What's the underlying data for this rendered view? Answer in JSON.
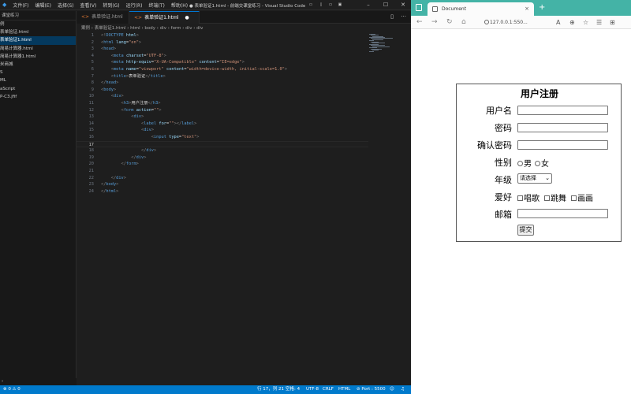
{
  "vscode": {
    "menu": [
      "文件(F)",
      "编辑(E)",
      "选择(S)",
      "查看(V)",
      "转到(G)",
      "运行(R)",
      "终端(T)",
      "帮助(H)"
    ],
    "window_title": "● 表单验证1.html - 前端交课堂练习 - Visual Studio Code",
    "sidebar_header": "课堂练习",
    "tree": [
      "例",
      "表单验证.html",
      "表单验证1.html",
      "简易计算器.html",
      "简易计算器1.html",
      "米商城",
      "S",
      "ML",
      "aScript",
      "P-C3.jfif"
    ],
    "tree_active_index": 2,
    "tabs": [
      {
        "label": "表单验证.html"
      },
      {
        "label": "表单验证1.html",
        "modified": "●"
      }
    ],
    "breadcrumb": "案例 › 表单验证1.html › html › body › div › form › div › div",
    "lines": [
      {
        "n": "1",
        "html": "<span class='p'>&lt;!</span><span class='t'>DOCTYPE</span> <span class='a'>html</span><span class='p'>&gt;</span>"
      },
      {
        "n": "2",
        "html": "<span class='p'>&lt;</span><span class='t'>html</span> <span class='a'>lang</span><span class='x'>=</span><span class='s'>\"en\"</span><span class='p'>&gt;</span>"
      },
      {
        "n": "3",
        "html": "<span class='p'>&lt;</span><span class='t'>head</span><span class='p'>&gt;</span>"
      },
      {
        "n": "4",
        "html": "    <span class='p'>&lt;</span><span class='t'>meta</span> <span class='a'>charset</span><span class='x'>=</span><span class='s'>\"UTF-8\"</span><span class='p'>&gt;</span>"
      },
      {
        "n": "5",
        "html": "    <span class='p'>&lt;</span><span class='t'>meta</span> <span class='a'>http-equiv</span><span class='x'>=</span><span class='s'>\"X-UA-Compatible\"</span> <span class='a'>content</span><span class='x'>=</span><span class='s'>\"IE=edge\"</span><span class='p'>&gt;</span>"
      },
      {
        "n": "6",
        "html": "    <span class='p'>&lt;</span><span class='t'>meta</span> <span class='a'>name</span><span class='x'>=</span><span class='s'>\"viewport\"</span> <span class='a'>content</span><span class='x'>=</span><span class='s'>\"width=device-width, initial-scale=1.0\"</span><span class='p'>&gt;</span>"
      },
      {
        "n": "7",
        "html": "    <span class='p'>&lt;</span><span class='t'>title</span><span class='p'>&gt;</span><span class='x'>表单验证</span><span class='p'>&lt;/</span><span class='t'>title</span><span class='p'>&gt;</span>"
      },
      {
        "n": "8",
        "html": "<span class='p'>&lt;/</span><span class='t'>head</span><span class='p'>&gt;</span>"
      },
      {
        "n": "9",
        "html": "<span class='p'>&lt;</span><span class='t'>body</span><span class='p'>&gt;</span>"
      },
      {
        "n": "10",
        "html": "    <span class='p'>&lt;</span><span class='t'>div</span><span class='p'>&gt;</span>"
      },
      {
        "n": "11",
        "html": "        <span class='p'>&lt;</span><span class='t'>h3</span><span class='p'>&gt;</span><span class='x'>用户注册</span><span class='p'>&lt;/</span><span class='t'>h3</span><span class='p'>&gt;</span>"
      },
      {
        "n": "12",
        "html": "        <span class='p'>&lt;</span><span class='t'>form</span> <span class='a'>action</span><span class='x'>=</span><span class='s'>\"\"</span><span class='p'>&gt;</span>"
      },
      {
        "n": "13",
        "html": "            <span class='p'>&lt;</span><span class='t'>div</span><span class='p'>&gt;</span>"
      },
      {
        "n": "14",
        "html": "                <span class='p'>&lt;</span><span class='t'>label</span> <span class='a'>for</span><span class='x'>=</span><span class='s'>\"\"</span><span class='p'>&gt;&lt;/</span><span class='t'>label</span><span class='p'>&gt;</span>"
      },
      {
        "n": "15",
        "html": "                <span class='p'>&lt;</span><span class='t'>div</span><span class='p'>&gt;</span>"
      },
      {
        "n": "16",
        "html": "                    <span class='p'>&lt;</span><span class='t'>input</span> <span class='a'>type</span><span class='x'>=</span><span class='s'>\"text\"</span><span class='p'>&gt;</span>"
      },
      {
        "n": "17",
        "html": "",
        "current": true
      },
      {
        "n": "18",
        "html": "                <span class='p'>&lt;/</span><span class='t'>div</span><span class='p'>&gt;</span>"
      },
      {
        "n": "19",
        "html": "            <span class='p'>&lt;/</span><span class='t'>div</span><span class='p'>&gt;</span>"
      },
      {
        "n": "20",
        "html": "        <span class='p'>&lt;/</span><span class='t'>form</span><span class='p'>&gt;</span>"
      },
      {
        "n": "21",
        "html": ""
      },
      {
        "n": "22",
        "html": "    <span class='p'>&lt;/</span><span class='t'>div</span><span class='p'>&gt;</span>"
      },
      {
        "n": "23",
        "html": "<span class='p'>&lt;/</span><span class='t'>body</span><span class='p'>&gt;</span>"
      },
      {
        "n": "24",
        "html": "<span class='p'>&lt;/</span><span class='t'>html</span><span class='p'>&gt;</span>"
      }
    ],
    "status": {
      "position": "行 17，列 21",
      "spaces": "空格: 4",
      "encoding": "UTF-8",
      "eol": "CRLF",
      "language": "HTML",
      "port": "⊘ Port : 5500"
    }
  },
  "browser": {
    "tab_title": "Document",
    "close": "×",
    "new_tab": "+",
    "url": "127.0.0.1:550...",
    "form": {
      "title": "用户注册",
      "labels": {
        "username": "用户名",
        "password": "密码",
        "confirm": "确认密码",
        "gender": "性别",
        "grade": "年级",
        "hobby": "爱好",
        "email": "邮箱"
      },
      "gender_options": [
        "男",
        "女"
      ],
      "grade_selected": "请选择",
      "hobby_options": [
        "唱歌",
        "跳舞",
        "画画"
      ],
      "submit": "提交"
    }
  }
}
